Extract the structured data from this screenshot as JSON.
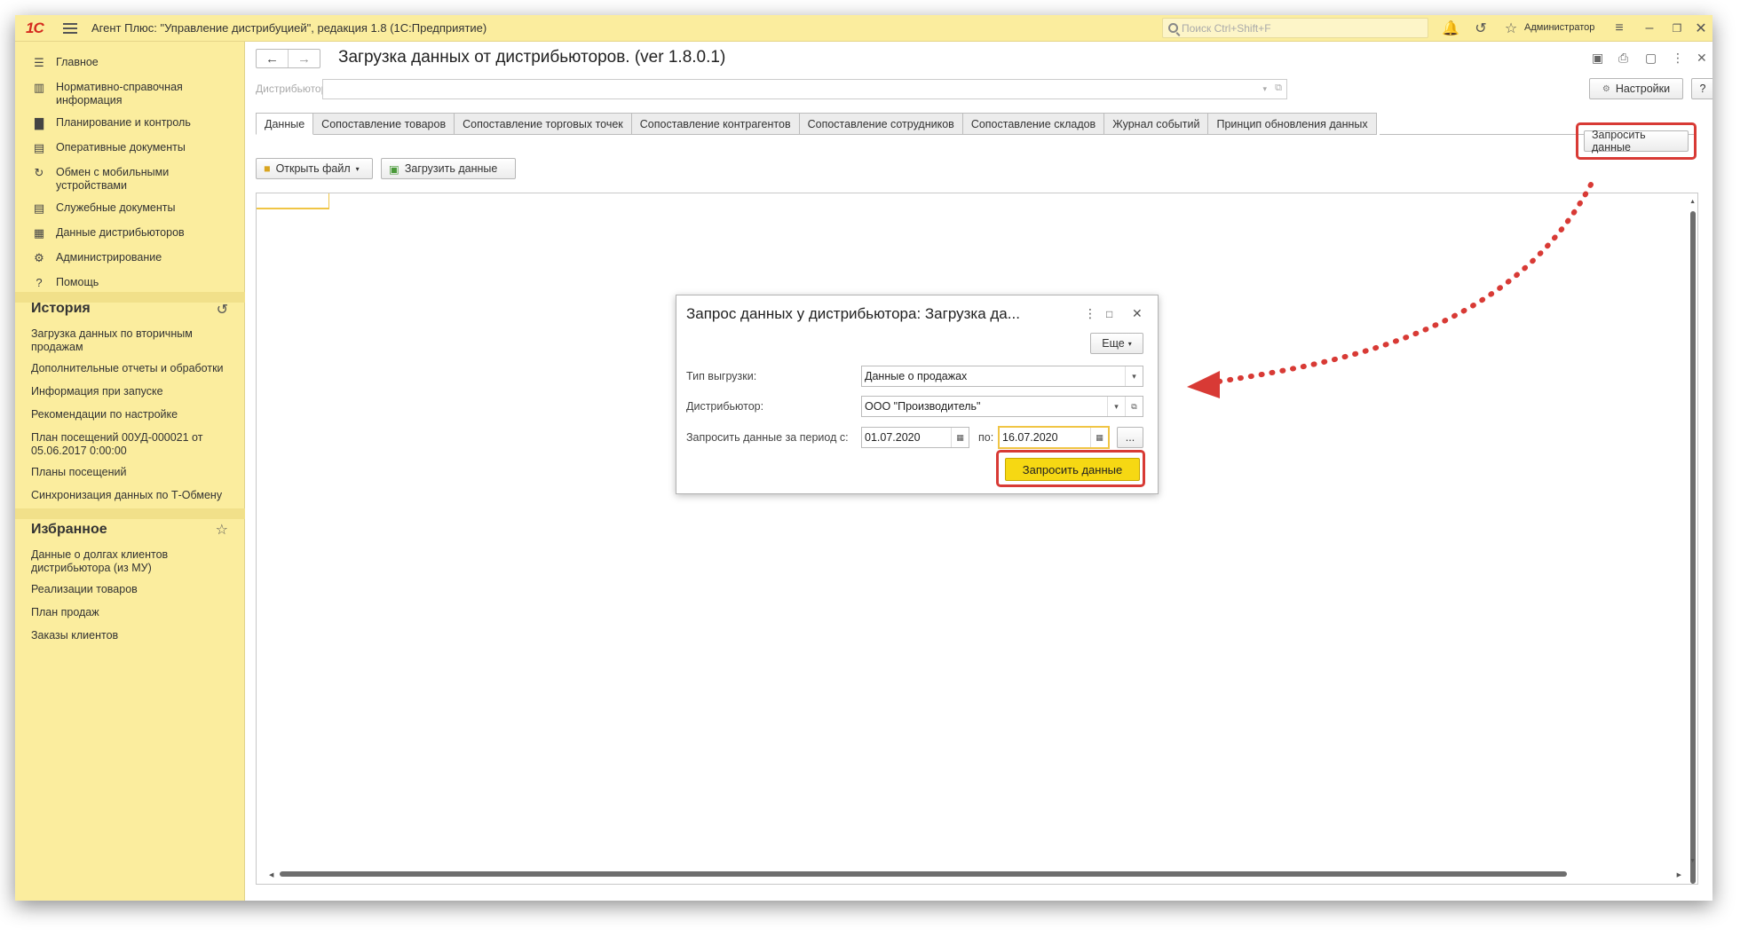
{
  "titlebar": {
    "logo": "1С",
    "title": "Агент Плюс: \"Управление дистрибуцией\", редакция 1.8  (1С:Предприятие)",
    "search_placeholder": "Поиск Ctrl+Shift+F",
    "user": "Администратор"
  },
  "sidebar": {
    "nav": [
      {
        "label": "Главное",
        "icon": "menu-icon"
      },
      {
        "label": "Нормативно-справочная информация",
        "icon": "book-icon"
      },
      {
        "label": "Планирование и контроль",
        "icon": "bar-chart-icon"
      },
      {
        "label": "Оперативные документы",
        "icon": "documents-icon"
      },
      {
        "label": "Обмен с мобильными устройствами",
        "icon": "sync-icon"
      },
      {
        "label": "Служебные документы",
        "icon": "documents-icon"
      },
      {
        "label": "Данные дистрибьюторов",
        "icon": "data-icon"
      },
      {
        "label": "Администрирование",
        "icon": "gear-icon"
      },
      {
        "label": "Помощь",
        "icon": "help-icon"
      }
    ],
    "history_title": "История",
    "history": [
      "Загрузка данных по вторичным продажам",
      "Дополнительные отчеты и обработки",
      "Информация при запуске",
      "Рекомендации по настройке",
      "План посещений 00УД-000021 от 05.06.2017 0:00:00",
      "Планы посещений",
      "Синхронизация данных по Т-Обмену"
    ],
    "favorites_title": "Избранное",
    "favorites": [
      "Данные о долгах клиентов дистрибьютора (из МУ)",
      "Реализации товаров",
      "План продаж",
      "Заказы клиентов"
    ]
  },
  "main": {
    "title": "Загрузка данных от дистрибьюторов. (ver 1.8.0.1)",
    "distributor_label": "Дистрибьютор:",
    "settings_btn": "Настройки",
    "help_btn": "?",
    "tabs": [
      "Данные",
      "Сопоставление товаров",
      "Сопоставление торговых точек",
      "Сопоставление контрагентов",
      "Сопоставление сотрудников",
      "Сопоставление складов",
      "Журнал событий",
      "Принцип обновления данных"
    ],
    "open_file_btn": "Открыть файл",
    "load_data_btn": "Загрузить данные",
    "request_data_btn": "Запросить данные"
  },
  "dialog": {
    "title": "Запрос данных у дистрибьютора: Загрузка да...",
    "more_btn": "Еще",
    "type_label": "Тип выгрузки:",
    "type_value": "Данные о продажах",
    "distributor_label": "Дистрибьютор:",
    "distributor_value": "ООО \"Производитель\"",
    "period_label": "Запросить данные за период с:",
    "date_from": "01.07.2020",
    "to_label": "по:",
    "date_to": "16.07.2020",
    "dots_btn": "...",
    "submit_btn": "Запросить данные"
  },
  "colors": {
    "panel": "#fbed9e",
    "highlight": "#d83a35",
    "primary_button": "#f6d813"
  }
}
